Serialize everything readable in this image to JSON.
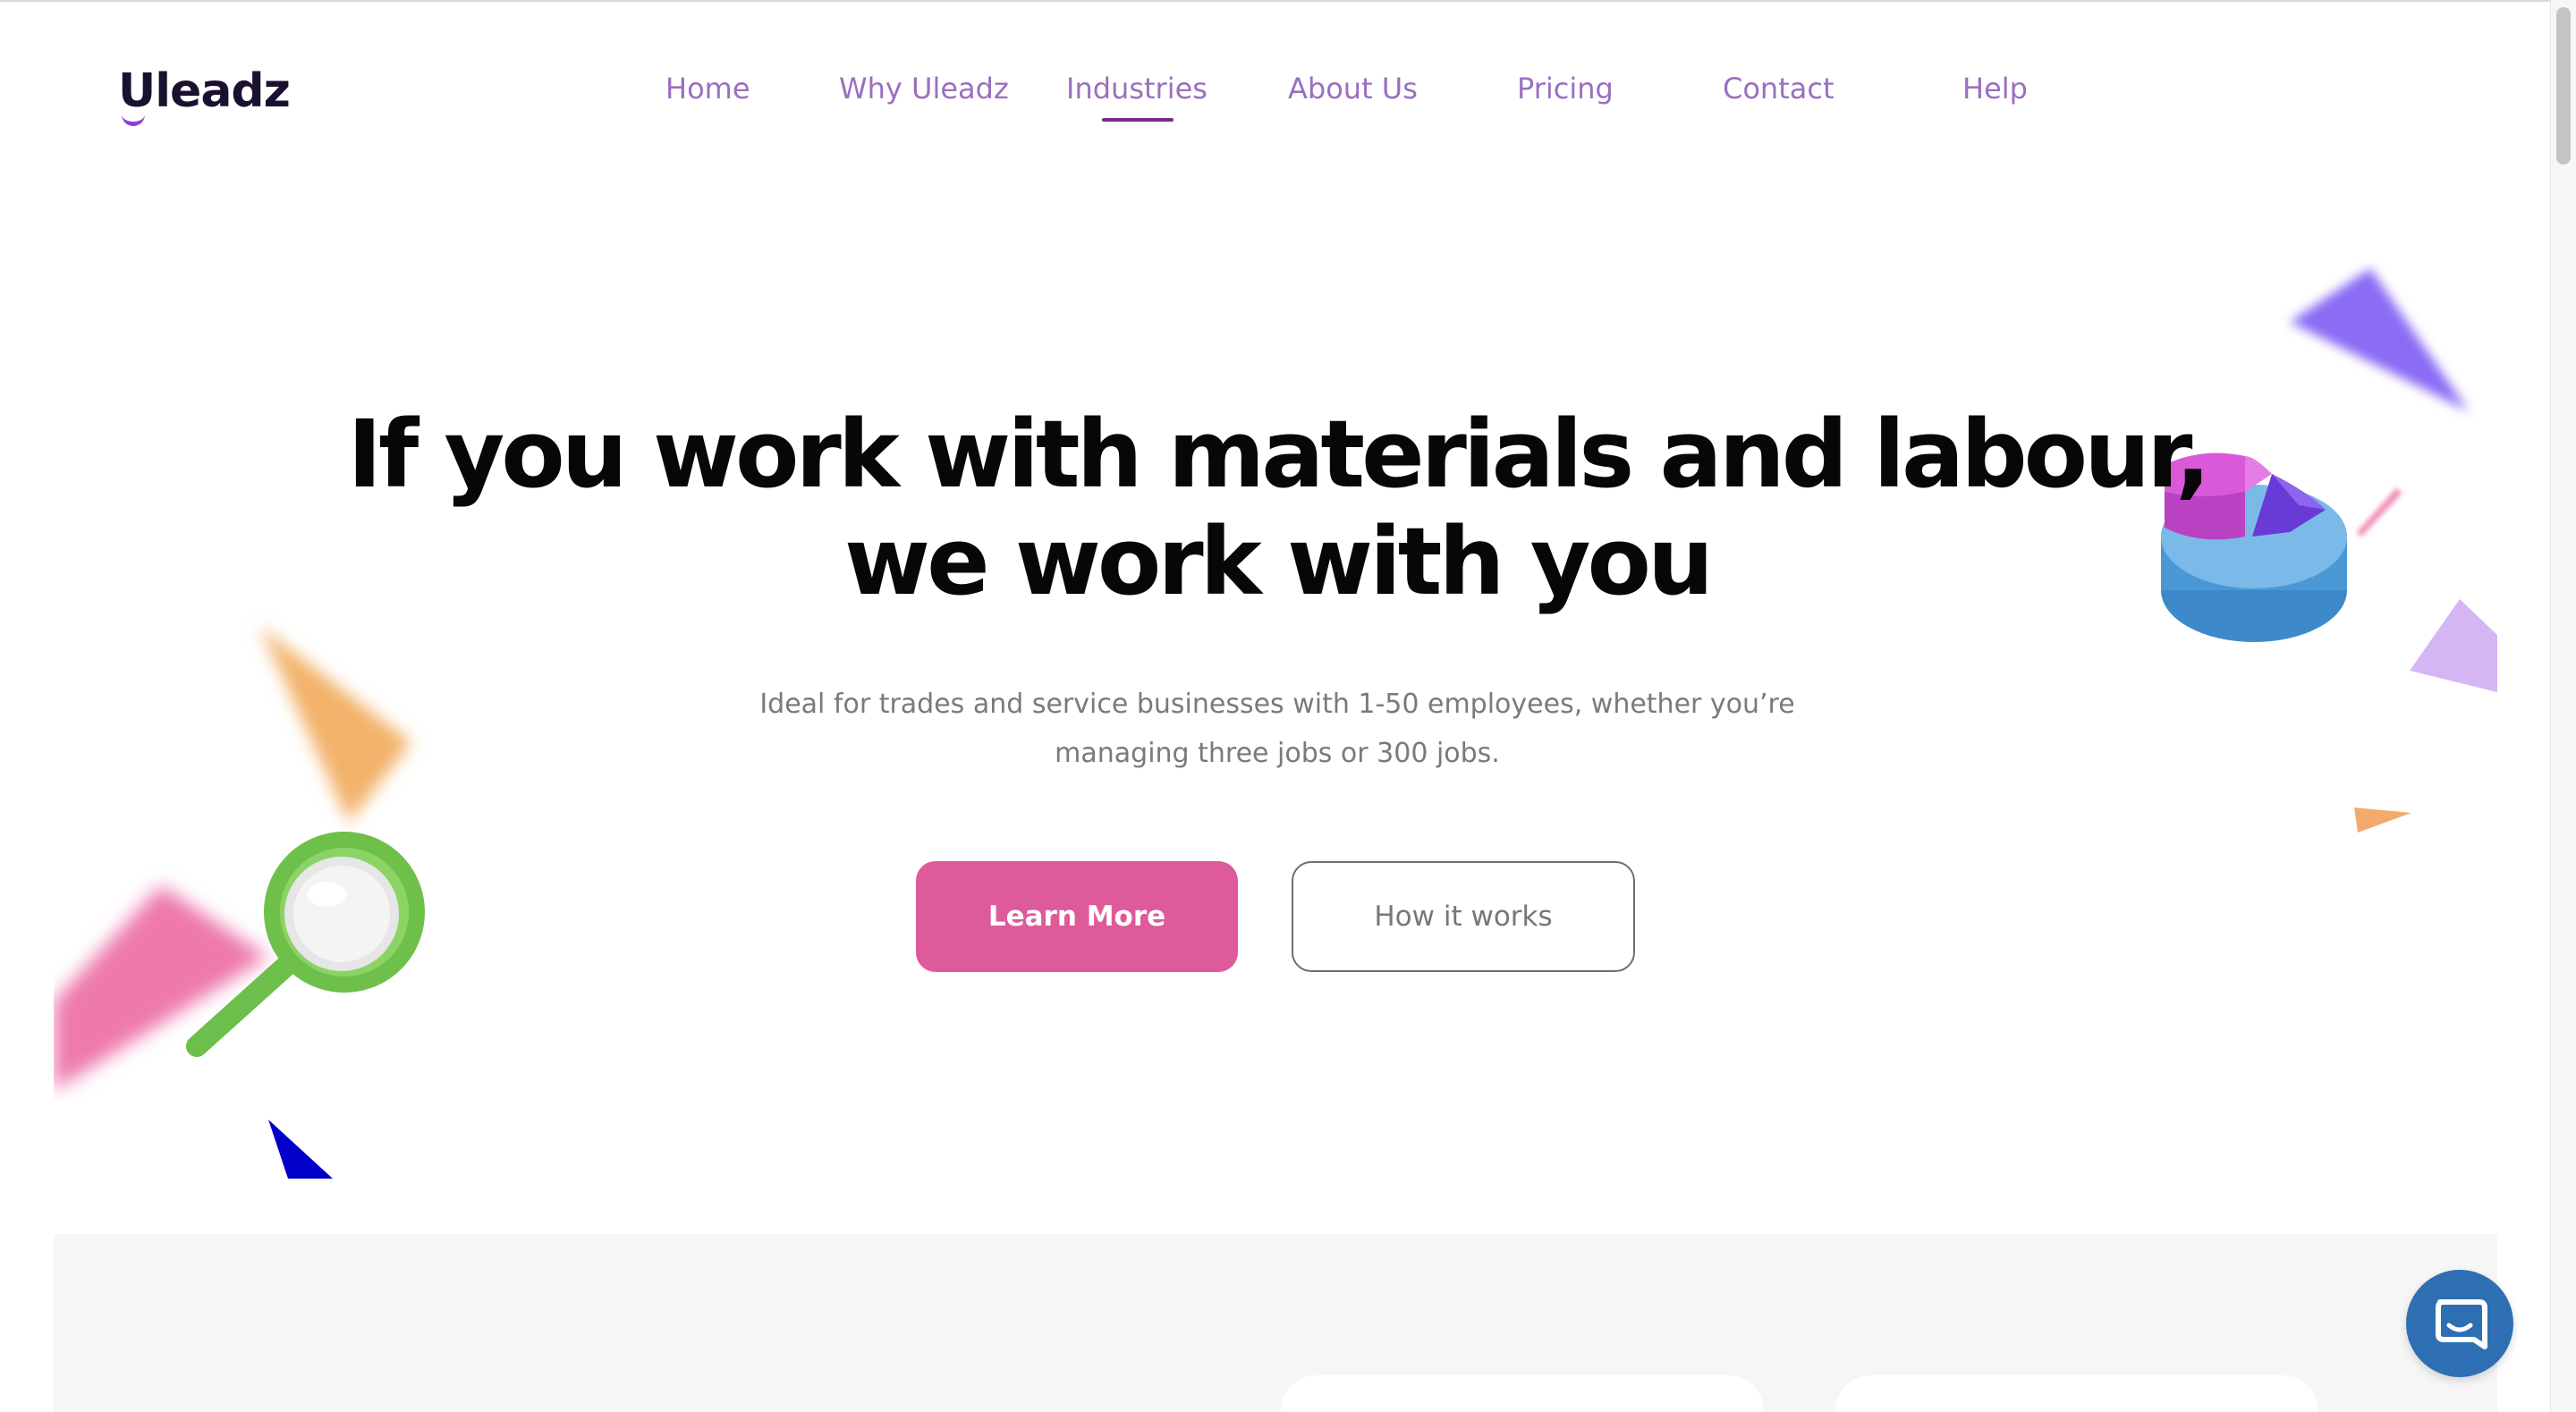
{
  "brand": {
    "logo_text": "Uleadz"
  },
  "nav": {
    "items": [
      {
        "label": "Home"
      },
      {
        "label": "Why Uleadz"
      },
      {
        "label": "Industries"
      },
      {
        "label": "About Us"
      },
      {
        "label": "Pricing"
      },
      {
        "label": "Contact"
      },
      {
        "label": "Help"
      }
    ],
    "active": "Industries"
  },
  "hero": {
    "title_line1": "If you work with materials and labour,",
    "title_line2": "we work with you",
    "subtitle_line1": "Ideal for trades and service businesses with 1-50 employees, whether you’re",
    "subtitle_line2": "managing three jobs or 300 jobs.",
    "primary_button": "Learn More",
    "secondary_button": "How it works"
  },
  "colors": {
    "primary_button": "#dd5a9b",
    "nav_text": "#9a6fbf",
    "nav_active_underline": "#7a2b8a",
    "chat_button": "#2e6fb4"
  },
  "icons": {
    "chat": "chat-bubble-icon",
    "magnifier": "magnifying-glass-illustration",
    "pie": "pie-chart-illustration"
  }
}
